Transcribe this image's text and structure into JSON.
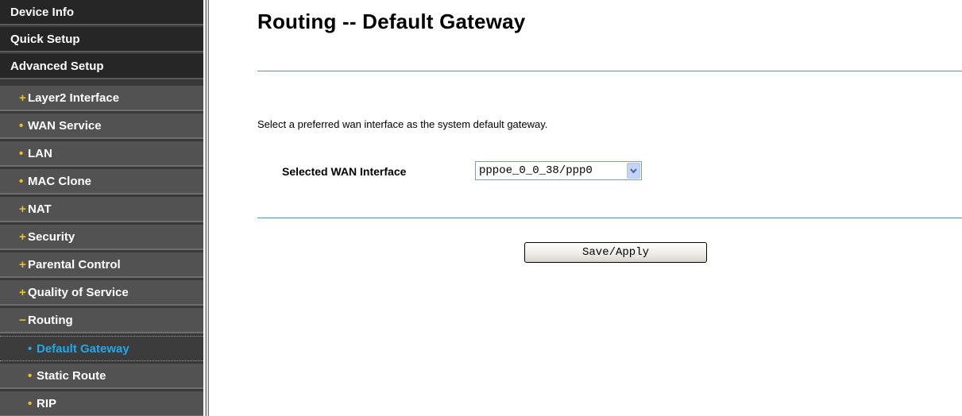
{
  "sidebar": {
    "items": [
      {
        "label": "Device Info",
        "level": "top"
      },
      {
        "label": "Quick Setup",
        "level": "top"
      },
      {
        "label": "Advanced Setup",
        "level": "top"
      },
      {
        "bullet": "+",
        "label": "Layer2 Interface",
        "level": "sub"
      },
      {
        "bullet": "•",
        "label": "WAN Service",
        "level": "sub"
      },
      {
        "bullet": "•",
        "label": "LAN",
        "level": "sub"
      },
      {
        "bullet": "•",
        "label": "MAC Clone",
        "level": "sub"
      },
      {
        "bullet": "+",
        "label": "NAT",
        "level": "sub"
      },
      {
        "bullet": "+",
        "label": "Security",
        "level": "sub"
      },
      {
        "bullet": "+",
        "label": "Parental Control",
        "level": "sub"
      },
      {
        "bullet": "+",
        "label": "Quality of Service",
        "level": "sub"
      },
      {
        "bullet": "−",
        "label": "Routing",
        "level": "sub"
      },
      {
        "bullet": "•",
        "label": "Default Gateway",
        "level": "subsub",
        "active": true
      },
      {
        "bullet": "•",
        "label": "Static Route",
        "level": "subsub"
      },
      {
        "bullet": "•",
        "label": "RIP",
        "level": "subsub"
      }
    ]
  },
  "main": {
    "title": "Routing -- Default Gateway",
    "description": "Select a preferred wan interface as the system default gateway.",
    "wan_interface": {
      "label": "Selected WAN Interface",
      "value": "pppoe_0_0_38/ppp0"
    },
    "save_label": "Save/Apply"
  },
  "colors": {
    "sidebar_bg": "#393939",
    "active_item_text": "#20a8e8",
    "bullet": "#f0c020",
    "rule": "#5a8fb0"
  },
  "icons": {
    "select_arrow": "chevron-down-icon"
  }
}
